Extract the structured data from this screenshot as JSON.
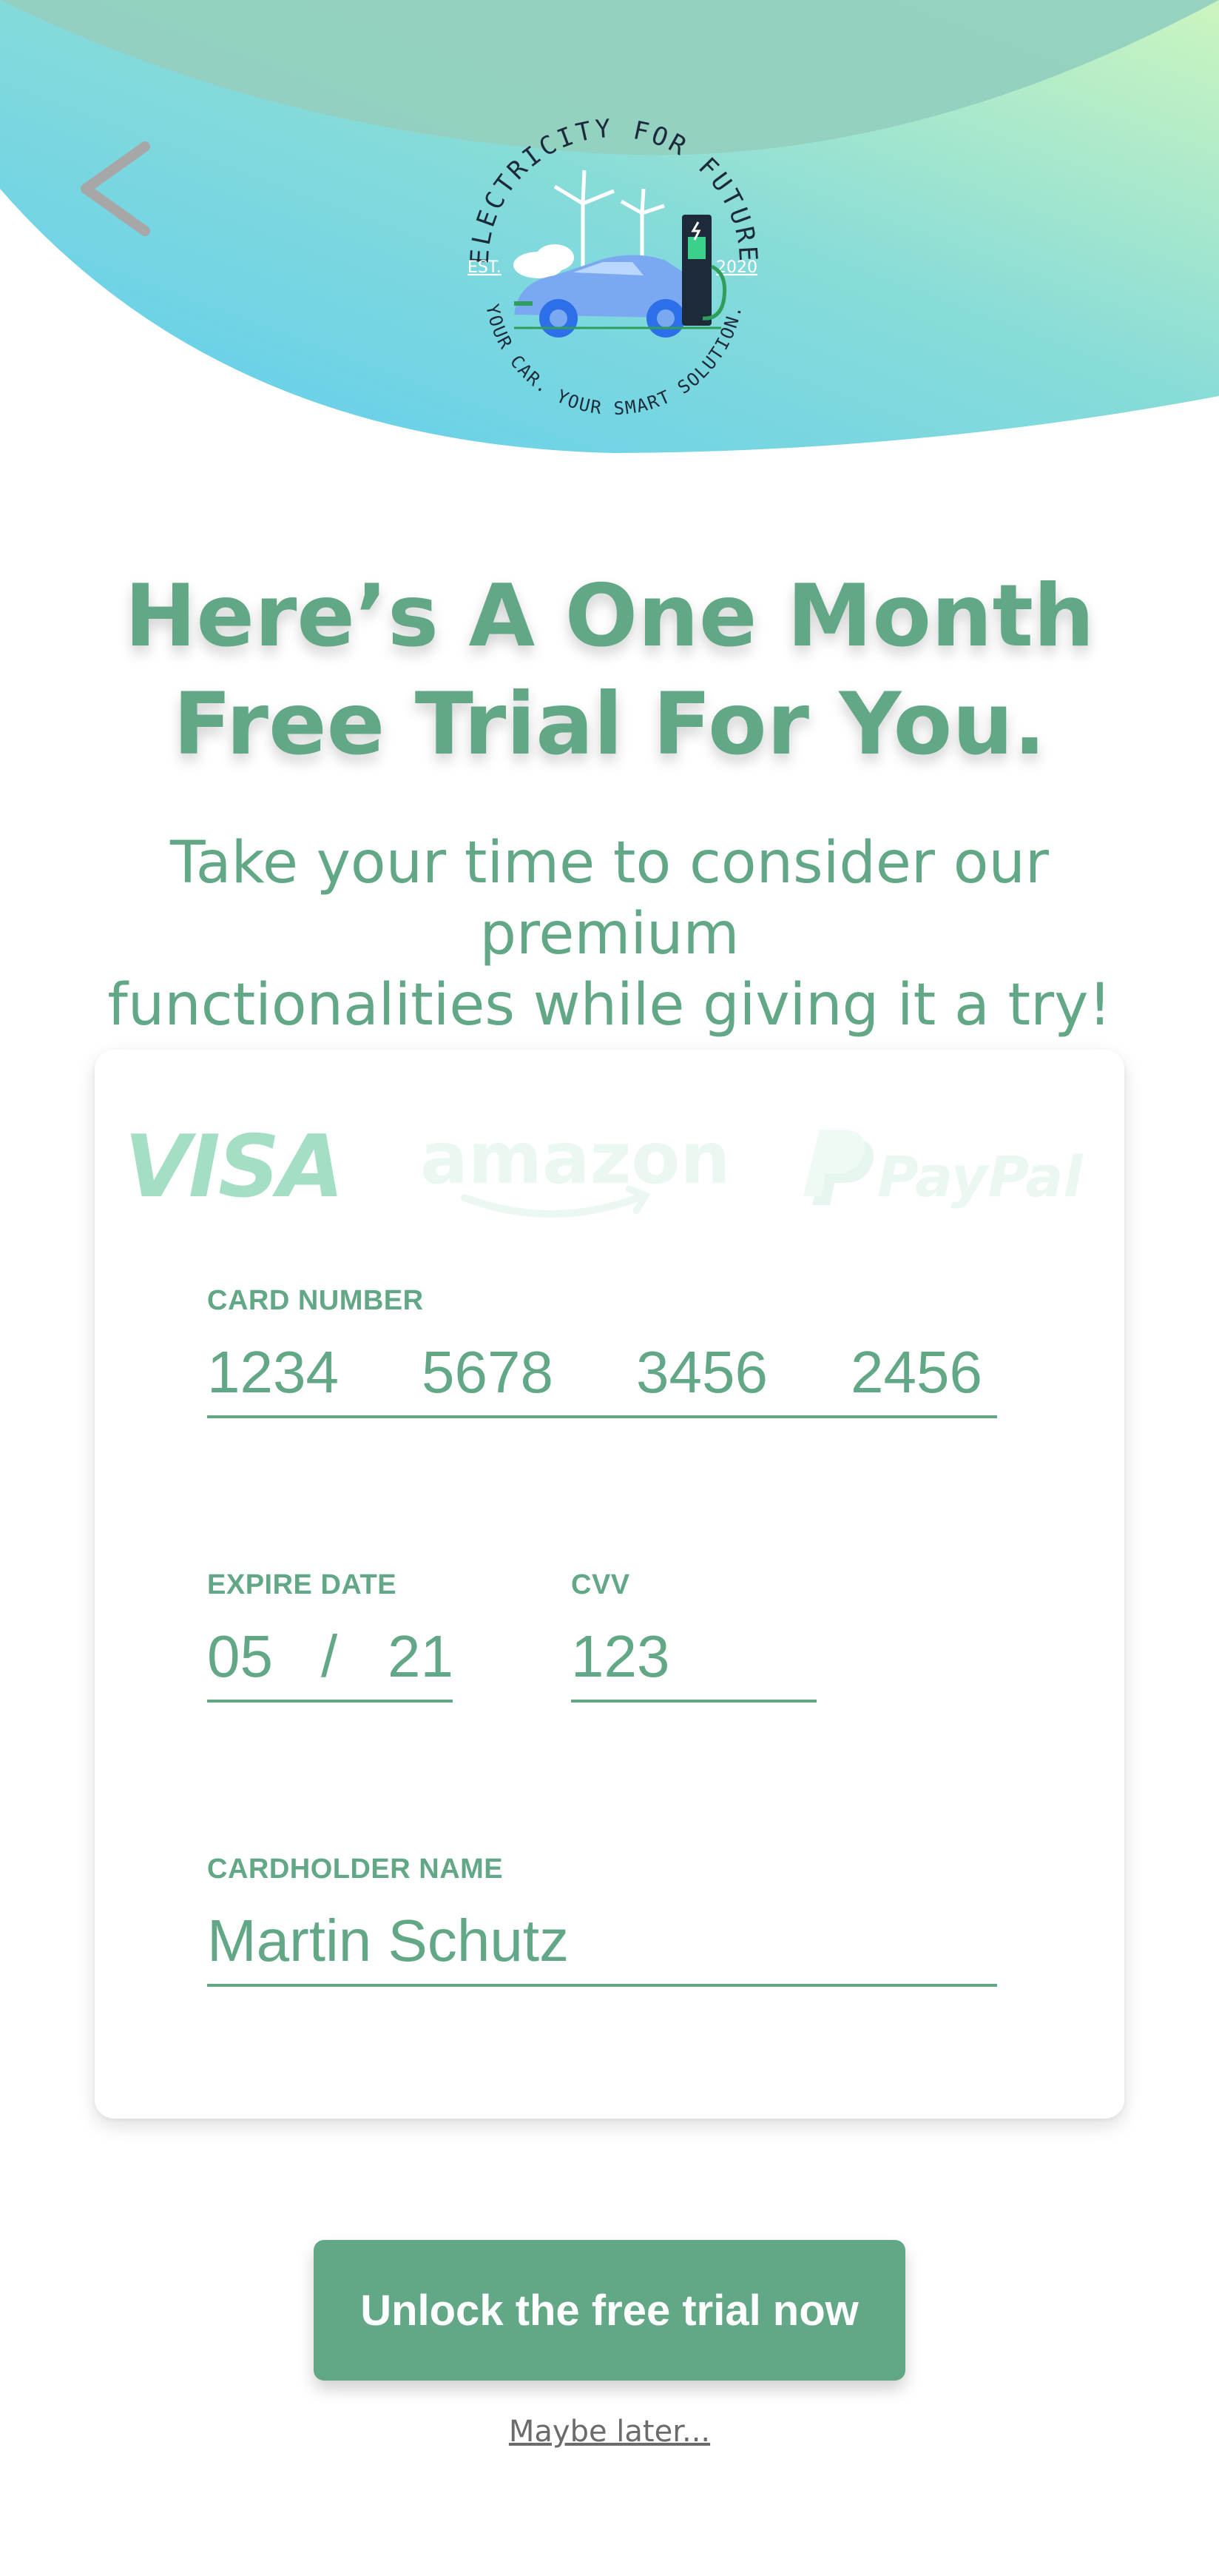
{
  "header": {
    "back_icon": "chevron-left-icon",
    "logo": {
      "top_text": "ELECTRICITY FOR FUTURE",
      "bottom_text": "YOUR CAR. YOUR SMART SOLUTION.",
      "est_label": "EST.",
      "year": "2020",
      "icon": "ev-charging-car-logo"
    }
  },
  "hero": {
    "title_line1": "Here’s A One Month",
    "title_line2": "Free Trial For You.",
    "subtitle_line1": "Take your time to consider our premium",
    "subtitle_line2": "functionalities while giving it a try!"
  },
  "payment": {
    "providers": [
      "VISA",
      "amazon",
      "PayPal"
    ],
    "card_number": {
      "label": "CARD NUMBER",
      "groups": [
        "1234",
        "5678",
        "3456",
        "2456"
      ]
    },
    "expire": {
      "label": "EXPIRE DATE",
      "month": "05",
      "separator": "/",
      "year": "21"
    },
    "cvv": {
      "label": "CVV",
      "value": "123"
    },
    "cardholder": {
      "label": "CARDHOLDER NAME",
      "value": "Martin Schutz"
    }
  },
  "actions": {
    "primary": "Unlock the free trial now",
    "secondary": "Maybe later..."
  },
  "colors": {
    "accent": "#62a887",
    "gradient_blue": "#6bd0ee",
    "gradient_green": "#c5f2c2",
    "top_arc": "#93d0c0"
  }
}
